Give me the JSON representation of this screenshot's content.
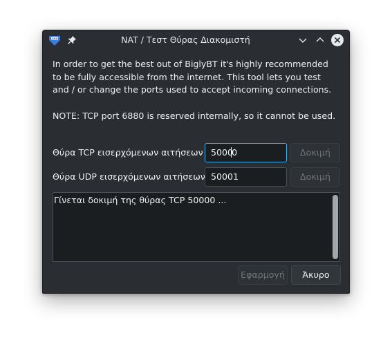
{
  "window": {
    "title": "NAT / Τεστ Θύρας Διακομιστή"
  },
  "intro": {
    "line1": "In order to get the best out of BiglyBT it's highly recommended",
    "line2": "to be fully accessible from the internet. This tool lets you test",
    "line3": "and / or change the ports used to accept incoming connections.",
    "note": "NOTE: TCP port 6880 is reserved internally, so it cannot be used."
  },
  "tcp": {
    "label": "Θύρα TCP εισερχόμενων αιτήσεων",
    "value_before_caret": "5000",
    "value_after_caret": "0",
    "test_label": "Δοκιμή"
  },
  "udp": {
    "label": "Θύρα UDP εισερχόμενων αιτήσεων",
    "value": "50001",
    "test_label": "Δοκιμή"
  },
  "log": {
    "text": "Γίνεται δοκιμή της θύρας  TCP 50000 ..."
  },
  "buttons": {
    "apply": "Εφαρμογή",
    "cancel": "Άκυρο"
  },
  "colors": {
    "window_bg": "#2a2e32",
    "field_bg": "#1b1e20",
    "focus_accent": "#3daee9",
    "close_button": "#e6e8ea",
    "app_icon_blue": "#3d7bdc"
  },
  "icons": {
    "app": "biglybt-app-icon",
    "pin": "pin-icon",
    "minimize": "chevron-down-icon",
    "maximize": "chevron-up-icon",
    "close": "close-icon"
  }
}
